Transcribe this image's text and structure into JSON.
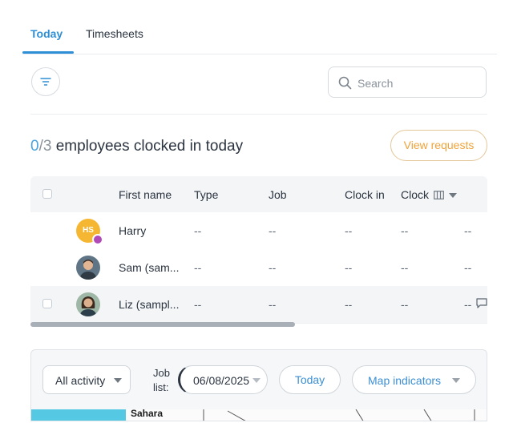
{
  "tabs": [
    {
      "label": "Today",
      "active": true
    },
    {
      "label": "Timesheets",
      "active": false
    }
  ],
  "toolbar": {
    "filter_icon": "filter-icon",
    "search_placeholder": "Search",
    "search_value": ""
  },
  "summary": {
    "clocked_in": "0",
    "separator": "/",
    "total": "3",
    "text": "employees clocked in today",
    "view_requests_label": "View requests"
  },
  "table": {
    "columns": [
      "First name",
      "Type",
      "Job",
      "Clock in",
      "Clock"
    ],
    "rows": [
      {
        "avatar": "HS",
        "name": "Harry",
        "type": "--",
        "job": "--",
        "clock_in": "--",
        "clock": "--",
        "extra": "--"
      },
      {
        "avatar": "photo",
        "name": "Sam (sam...",
        "type": "--",
        "job": "--",
        "clock_in": "--",
        "clock": "--",
        "extra": "--"
      },
      {
        "avatar": "photo",
        "name": "Liz (sampl...",
        "type": "--",
        "job": "--",
        "clock_in": "--",
        "clock": "--",
        "extra": "--"
      }
    ]
  },
  "map_controls": {
    "activity_select": "All activity",
    "job_list_label_line1": "Job",
    "job_list_label_line2": "list:",
    "date_value": "06/08/2025",
    "today_label": "Today",
    "map_indicators_label": "Map indicators",
    "map_place_label": "Sahara"
  },
  "colors": {
    "accent_blue": "#2f8fd6",
    "orange": "#f0a33a",
    "avatar_yellow": "#f5b731",
    "badge_purple": "#b04ab8"
  }
}
